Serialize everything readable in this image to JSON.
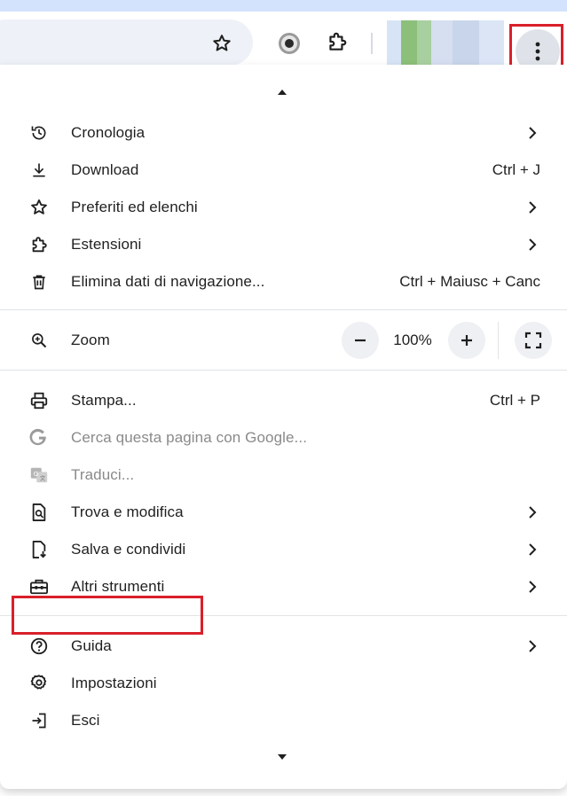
{
  "colors": {
    "highlight": "#d9202b",
    "text": "#1f1f1f",
    "disabled_text": "#8a8a8a",
    "menu_button_bg": "#dfe3e9"
  },
  "toolbar": {
    "icons": [
      "star-icon",
      "record-icon",
      "extensions-icon",
      "more-vert-icon"
    ]
  },
  "menu": {
    "group1": [
      {
        "label": "Cronologia",
        "icon": "history-icon",
        "submenu": true
      },
      {
        "label": "Download",
        "icon": "download-icon",
        "shortcut": "Ctrl + J"
      },
      {
        "label": "Preferiti ed elenchi",
        "icon": "star-icon",
        "submenu": true
      },
      {
        "label": "Estensioni",
        "icon": "extension-icon",
        "submenu": true
      },
      {
        "label": "Elimina dati di navigazione...",
        "icon": "trash-icon",
        "shortcut": "Ctrl + Maiusc + Canc"
      }
    ],
    "zoom": {
      "label": "Zoom",
      "icon": "zoom-icon",
      "value": "100%",
      "minus": "−",
      "plus": "+"
    },
    "group2": [
      {
        "label": "Stampa...",
        "icon": "print-icon",
        "shortcut": "Ctrl + P"
      },
      {
        "label": "Cerca questa pagina con Google...",
        "icon": "google-icon",
        "disabled": true
      },
      {
        "label": "Traduci...",
        "icon": "translate-icon",
        "disabled": true
      },
      {
        "label": "Trova e modifica",
        "icon": "find-icon",
        "submenu": true
      },
      {
        "label": "Salva e condividi",
        "icon": "save-share-icon",
        "submenu": true
      },
      {
        "label": "Altri strumenti",
        "icon": "toolbox-icon",
        "submenu": true
      }
    ],
    "group3": [
      {
        "label": "Guida",
        "icon": "help-icon",
        "submenu": true
      },
      {
        "label": "Impostazioni",
        "icon": "settings-icon"
      },
      {
        "label": "Esci",
        "icon": "exit-icon"
      }
    ]
  }
}
